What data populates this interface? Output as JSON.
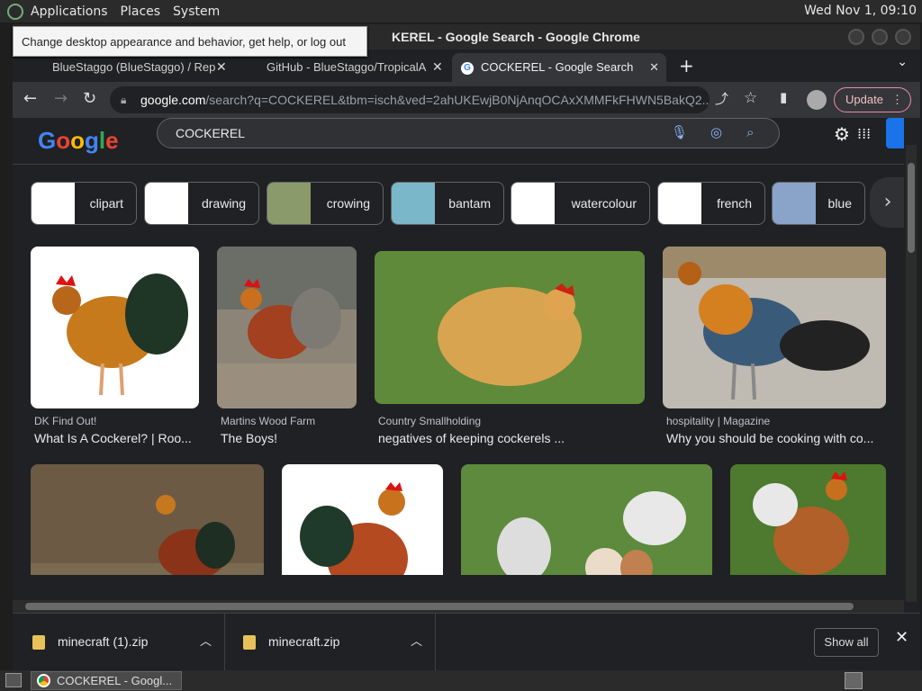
{
  "desktop": {
    "menu": [
      "Applications",
      "Places",
      "System"
    ],
    "clock": "Wed Nov 1, 09:10",
    "tooltip": "Change desktop appearance and behavior, get help, or log out"
  },
  "window": {
    "title": "KEREL - Google Search - Google Chrome"
  },
  "tabs": [
    {
      "label": "BlueStaggo (BlueStaggo) / Rep"
    },
    {
      "label": "GitHub - BlueStaggo/TropicalA"
    },
    {
      "label": "COCKEREL - Google Search"
    }
  ],
  "toolbar": {
    "url_host": "google.com",
    "url_path": "/search?q=COCKEREL&tbm=isch&ved=2ahUKEwjB0NjAnqOCAxXMMFkFHWN5BakQ2...",
    "update_label": "Update"
  },
  "google": {
    "logo": "Google",
    "query": "COCKEREL"
  },
  "chips": [
    {
      "label": "clipart"
    },
    {
      "label": "drawing"
    },
    {
      "label": "crowing"
    },
    {
      "label": "bantam"
    },
    {
      "label": "watercolour"
    },
    {
      "label": "french"
    },
    {
      "label": "blue"
    }
  ],
  "results": [
    {
      "source": "DK Find Out!",
      "title": "What Is A Cockerel? | Roo..."
    },
    {
      "source": "Martins Wood Farm",
      "title": "The Boys!"
    },
    {
      "source": "Country Smallholding",
      "title": "negatives of keeping cockerels ..."
    },
    {
      "source": "hospitality | Magazine",
      "title": "Why you should be cooking with co..."
    }
  ],
  "downloads": [
    {
      "name": "minecraft (1).zip"
    },
    {
      "name": "minecraft.zip"
    }
  ],
  "downloads_bar": {
    "show_all": "Show all"
  },
  "taskbar": {
    "task": "COCKEREL - Googl..."
  }
}
